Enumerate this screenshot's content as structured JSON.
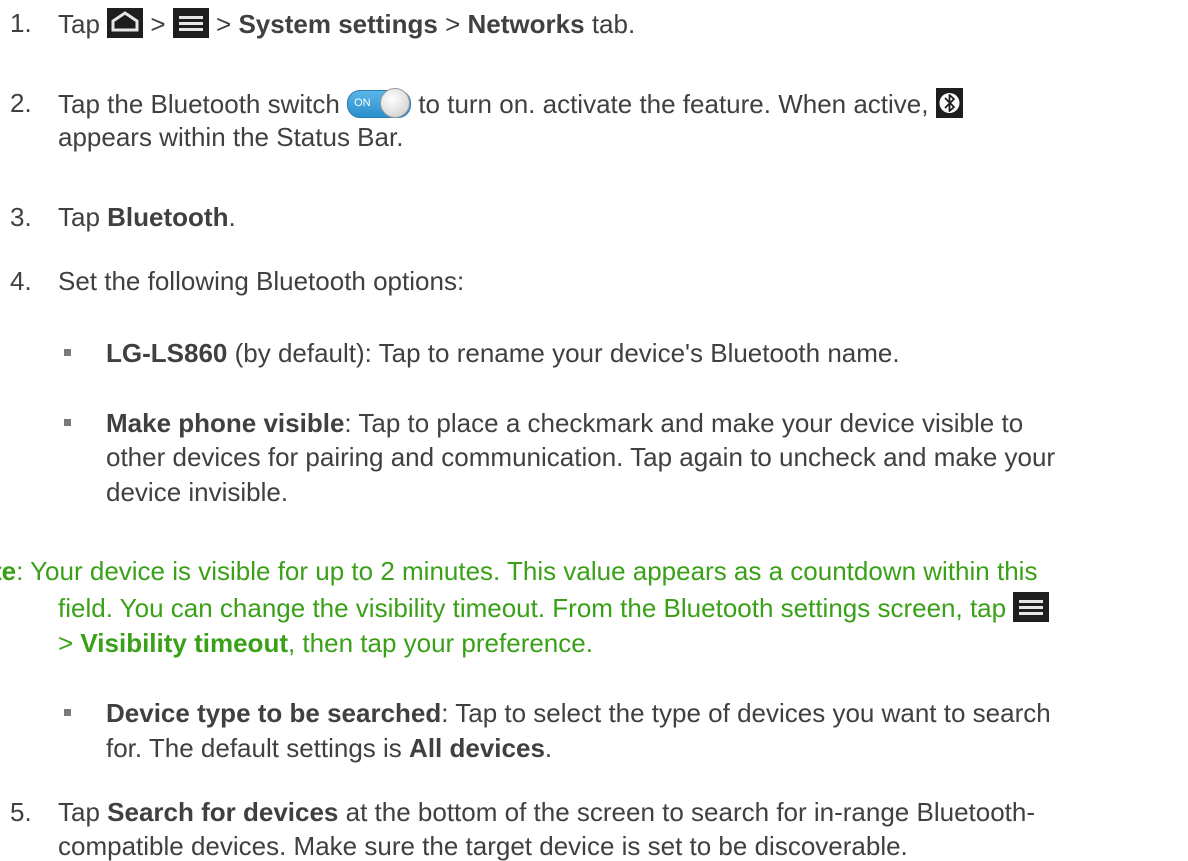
{
  "steps": {
    "s1": {
      "num": "1.",
      "tap": "Tap",
      "sep1": ">",
      "sep2": ">",
      "system_settings": "System settings",
      "sep3": ">",
      "networks": "Networks",
      "tab": "tab."
    },
    "s2": {
      "num": "2.",
      "before": "Tap the Bluetooth switch",
      "switch_label": "ON",
      "after": "to turn on. activate the feature. When active,",
      "line2": "appears within the Status Bar."
    },
    "s3": {
      "num": "3.",
      "tap": "Tap",
      "bluetooth": "Bluetooth",
      "period": "."
    },
    "s4": {
      "num": "4.",
      "text": "Set the following Bluetooth options:"
    },
    "opt1": {
      "name": "LG-LS860",
      "rest": "(by default): Tap to rename your device's Bluetooth name."
    },
    "opt2": {
      "name": "Make phone visible",
      "rest1": ": Tap to place a checkmark and make your device visible to",
      "line2": "other devices for pairing and communication. Tap again to uncheck and make your",
      "line3": "device invisible."
    },
    "note": {
      "label": "te",
      "line1": ":  Your device is visible for up to 2 minutes. This value appears as a countdown within this",
      "line2": "field. You can change the visibility timeout. From the Bluetooth settings screen, tap",
      "line3_sep": ">",
      "line3_bold": "Visibility timeout",
      "line3_rest": ", then tap your preference."
    },
    "opt3": {
      "name": "Device type to be searched",
      "rest1": ": Tap to select the type of devices you want to search",
      "line2_a": "for. The default settings is",
      "line2_bold": "All devices",
      "line2_end": "."
    },
    "s5": {
      "num": "5.",
      "tap": "Tap",
      "bold": "Search for devices",
      "rest1": "at the bottom of the screen to search for in-range Bluetooth-",
      "line2": "compatible devices. Make sure the target device is set to be discoverable."
    }
  }
}
